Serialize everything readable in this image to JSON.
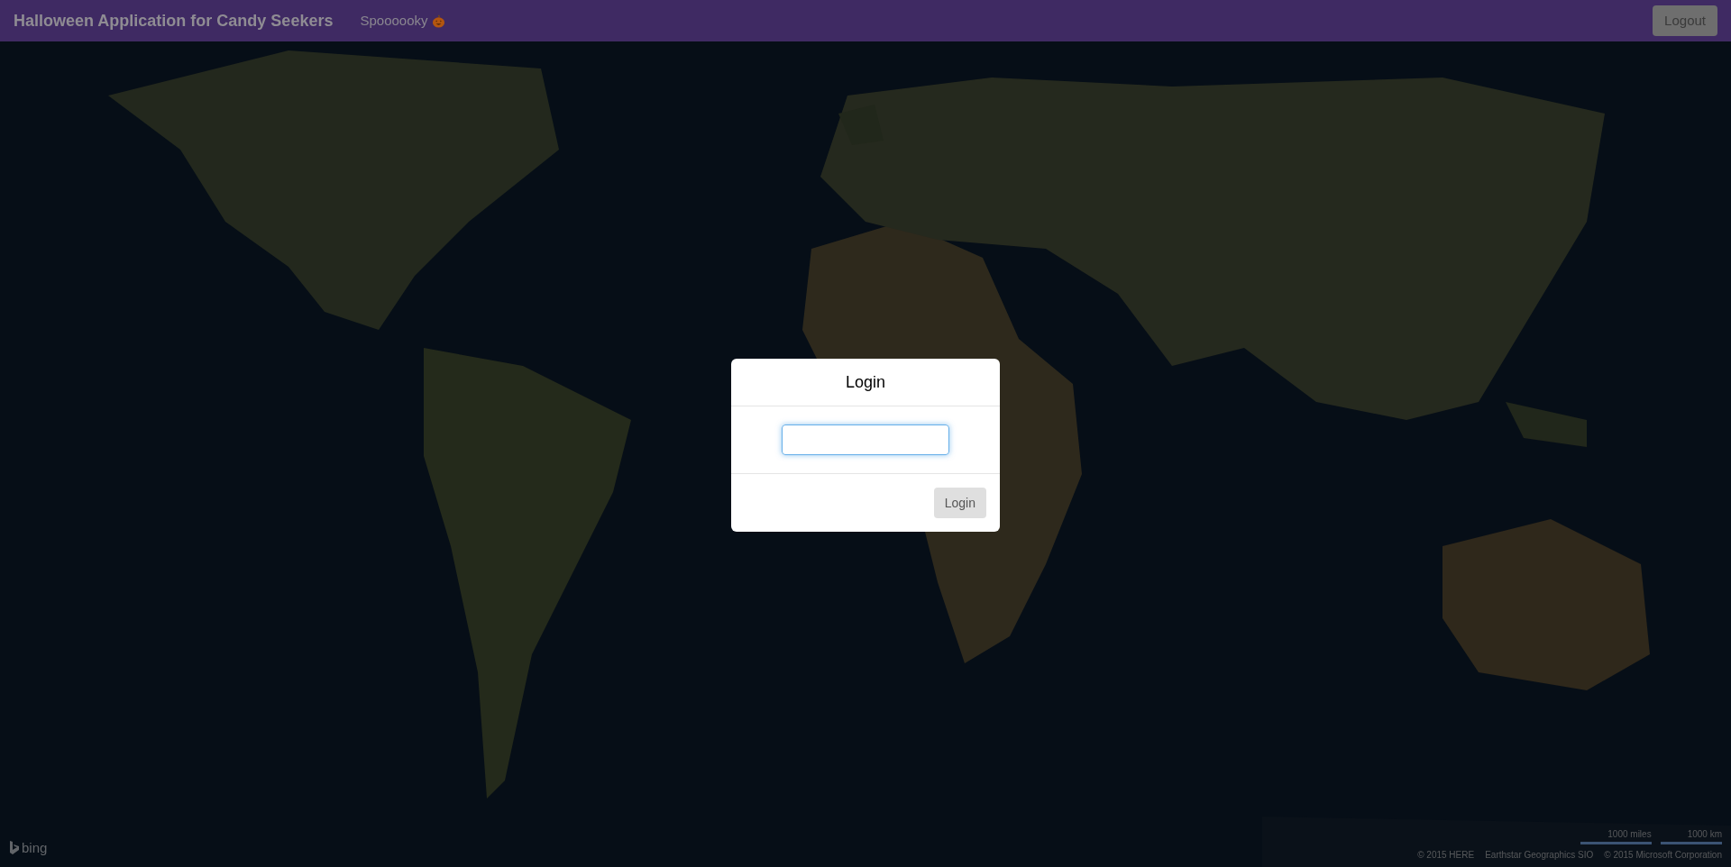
{
  "navbar": {
    "brand": "Halloween Application for Candy Seekers",
    "link": "Spoooooky",
    "logout": "Logout"
  },
  "map": {
    "logo": "bing",
    "scale": [
      "1000 miles",
      "1000 km"
    ],
    "attribution": [
      "© 2015 HERE",
      "Earthstar Geographics SIO",
      "© 2015 Microsoft Corporation"
    ]
  },
  "login_dialog": {
    "title": "Login",
    "input": {
      "focused": true
    },
    "button": "Login"
  }
}
